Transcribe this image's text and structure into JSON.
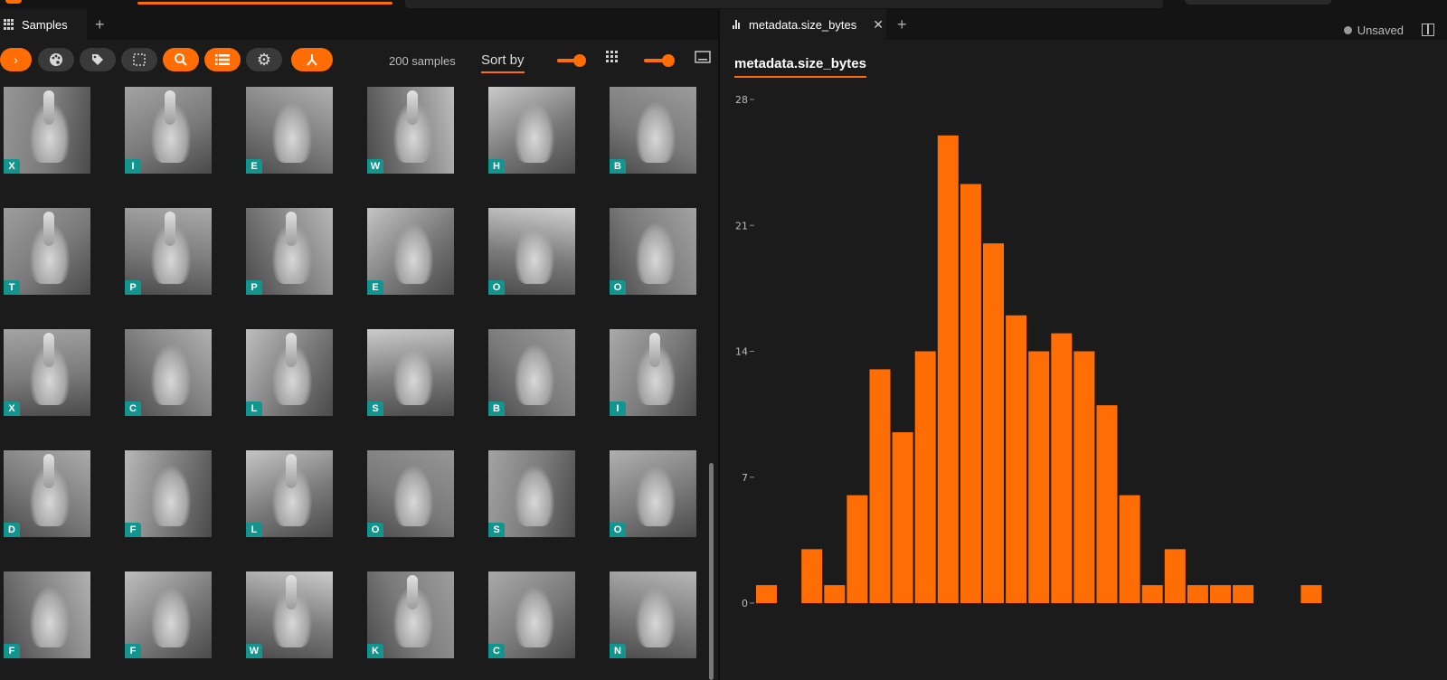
{
  "left_panel": {
    "tab_label": "Samples",
    "samples_count": "200 samples",
    "sort_label": "Sort by",
    "toolbar_icons": [
      "chevron-right-icon",
      "palette-icon",
      "tag-icon",
      "selection-icon",
      "search-icon",
      "list-icon",
      "gear-icon",
      "merge-icon"
    ],
    "gallery": [
      [
        "X",
        "I",
        "E",
        "W",
        "H",
        "B"
      ],
      [
        "T",
        "P",
        "P",
        "E",
        "O",
        "O"
      ],
      [
        "X",
        "C",
        "L",
        "S",
        "B",
        "I"
      ],
      [
        "D",
        "F",
        "L",
        "O",
        "S",
        "O"
      ],
      [
        "F",
        "F",
        "W",
        "K",
        "C",
        "N"
      ]
    ]
  },
  "right_panel": {
    "tab_label": "metadata.size_bytes",
    "status": "Unsaved",
    "panel_title": "metadata.size_bytes"
  },
  "colors": {
    "accent": "#ff6d04",
    "label_bg": "#13958f",
    "background": "#1b1b1b"
  },
  "chart_data": {
    "type": "bar",
    "title": "metadata.size_bytes",
    "ylim": [
      0,
      28
    ],
    "yticks": [
      "0",
      "7",
      "14",
      "21",
      "28"
    ],
    "values": [
      1,
      0,
      3,
      1,
      6,
      13,
      9.5,
      14,
      26,
      23.3,
      20,
      16,
      14,
      15,
      14,
      11,
      6,
      1,
      3,
      1,
      1,
      1,
      0,
      0,
      1
    ],
    "grid": false
  }
}
